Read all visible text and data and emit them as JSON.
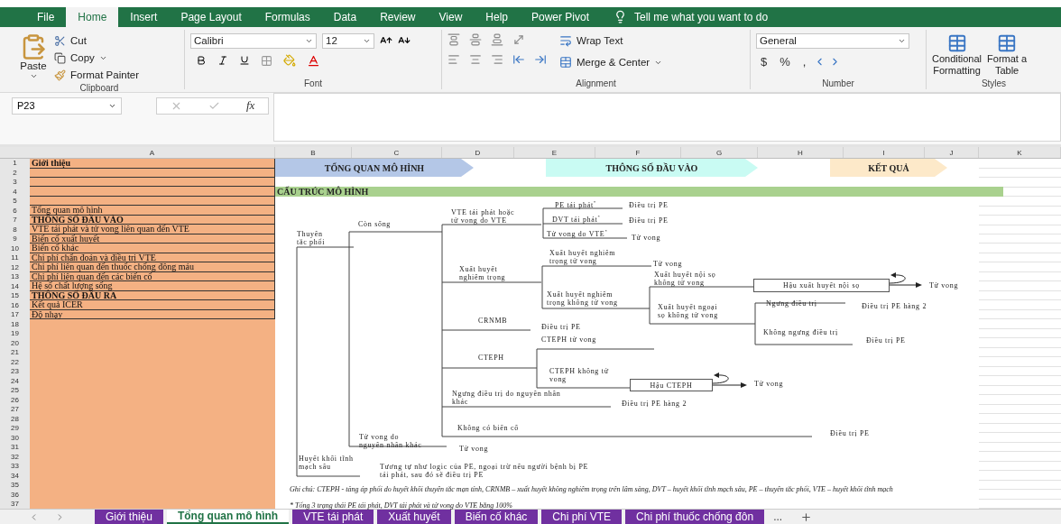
{
  "menu_tabs": [
    {
      "label": "File",
      "selected": false
    },
    {
      "label": "Home",
      "selected": true
    },
    {
      "label": "Insert",
      "selected": false
    },
    {
      "label": "Page Layout",
      "selected": false
    },
    {
      "label": "Formulas",
      "selected": false
    },
    {
      "label": "Data",
      "selected": false
    },
    {
      "label": "Review",
      "selected": false
    },
    {
      "label": "View",
      "selected": false
    },
    {
      "label": "Help",
      "selected": false
    },
    {
      "label": "Power Pivot",
      "selected": false
    }
  ],
  "tell_me": "Tell me what you want to do",
  "ribbon": {
    "clipboard": {
      "paste": "Paste",
      "cut": "Cut",
      "copy": "Copy",
      "format_painter": "Format Painter",
      "label": "Clipboard"
    },
    "font": {
      "name": "Calibri",
      "size": "12",
      "label": "Font"
    },
    "alignment": {
      "wrap_text": "Wrap Text",
      "merge_center": "Merge & Center",
      "label": "Alignment"
    },
    "number": {
      "format": "General",
      "symbols": [
        "$",
        "%",
        ","
      ],
      "label": "Number"
    },
    "styles": {
      "buttons": [
        {
          "line1": "Conditional",
          "line2": "Formatting"
        },
        {
          "line1": "Format a",
          "line2": "Table"
        }
      ],
      "label": "Styles"
    }
  },
  "formula_bar": {
    "name_box": "P23",
    "fx": "fx"
  },
  "columns": [
    "A",
    "B",
    "C",
    "D",
    "E",
    "F",
    "G",
    "H",
    "I",
    "J",
    "K"
  ],
  "rows": [
    {
      "number": "1",
      "text": "Giới thiệu",
      "kind": "heading"
    },
    {
      "number": "2",
      "kind": "empty"
    },
    {
      "number": "3",
      "kind": "empty"
    },
    {
      "number": "4",
      "kind": "empty"
    },
    {
      "number": "5",
      "kind": "empty"
    },
    {
      "number": "6",
      "text": "Tổng quan mô hình",
      "kind": "item"
    },
    {
      "number": "7",
      "text": "THÔNG SỐ ĐẦU VÀO",
      "kind": "heading"
    },
    {
      "number": "8",
      "text": "VTE tái phát và tử vong liên quan đến VTE",
      "kind": "item"
    },
    {
      "number": "9",
      "text": "Biến cố xuất huyết",
      "kind": "item"
    },
    {
      "number": "10",
      "text": "Biến cố khác",
      "kind": "item"
    },
    {
      "number": "11",
      "text": "Chi phí chẩn đoán và điều trị VTE",
      "kind": "item"
    },
    {
      "number": "12",
      "text": "Chi phí liên quan đến thuốc chống đông máu",
      "kind": "item"
    },
    {
      "number": "13",
      "text": "Chi phí liên quan đến các biến cố",
      "kind": "item"
    },
    {
      "number": "14",
      "text": "Hệ số chất lượng sống",
      "kind": "item"
    },
    {
      "number": "15",
      "text": "THÔNG SỐ ĐẦU RA",
      "kind": "heading"
    },
    {
      "number": "16",
      "text": "Kết quả ICER",
      "kind": "item"
    },
    {
      "number": "17",
      "text": "Độ nhạy",
      "kind": "item"
    },
    {
      "number": "18"
    },
    {
      "number": "19"
    },
    {
      "number": "20"
    },
    {
      "number": "21"
    },
    {
      "number": "22"
    },
    {
      "number": "23"
    },
    {
      "number": "24"
    },
    {
      "number": "25"
    },
    {
      "number": "26"
    },
    {
      "number": "27"
    },
    {
      "number": "28"
    },
    {
      "number": "29"
    },
    {
      "number": "30"
    },
    {
      "number": "31"
    },
    {
      "number": "32"
    },
    {
      "number": "33"
    },
    {
      "number": "34"
    },
    {
      "number": "35"
    },
    {
      "number": "36"
    },
    {
      "number": "37"
    }
  ],
  "banners": [
    {
      "text": "TỔNG QUAN MÔ HÌNH",
      "color": "#b4c7e7"
    },
    {
      "text": "THÔNG SỐ ĐẦU VÀO",
      "color": "#c9fbf3"
    },
    {
      "text": "KẾT QUẢ",
      "color": "#fde9c9"
    }
  ],
  "section_title": "CẤU TRÚC MÔ HÌNH",
  "diagram": {
    "labels": [
      "Thuyên\ntắc phổi",
      "Còn sống",
      "VTE tái phát hoặc\ntử vong do VTE",
      "PE tái phát$^{*}$",
      "Điều trị PE",
      "DVT tái phát$^{*}$",
      "Điều trị PE",
      "Tử vong do VTE$^{*}$",
      "Tử vong",
      "Xuất huyết nghiêm\ntrọng tử vong",
      "Tử vong",
      "Xuất huyết\nnghiêm trọng",
      "Xuất huyết nội sọ\nkhông tử vong",
      "Tử vong",
      "Xuất huyết nghiêm\ntrọng không tử vong",
      "Xuất huyết ngoại\nsọ không tử vong",
      "Ngưng điều trị",
      "Điều trị PE hàng 2",
      "CRNMB",
      "Điều trị PE",
      "CTEPH tử vong",
      "Không ngưng điều trị",
      "Điều trị PE",
      "CTEPH",
      "CTEPH không tử\nvong",
      "Tử vong",
      "Ngưng điều trị do nguyên nhân\nkhác",
      "Điều trị PE hàng 2",
      "Không có biến cố",
      "Điều trị PE",
      "Tử vong do\nnguyên nhân khác",
      "Tử vong",
      "Huyết khối tĩnh\nmạch sâu",
      "Tương tự như logic của PE, ngoại trừ nếu người bệnh bị PE\ntái phát, sau đó sẽ điều trị PE"
    ],
    "boxes": [
      "Hậu xuất huyết nội sọ",
      "Hậu CTEPH"
    ]
  },
  "notes": [
    "Ghi chú: CTEPH - tăng áp phổi do huyết khối thuyên tắc mạn tính, CRNMB – xuất huyết không nghiêm trọng trên lâm sàng, DVT – huyết khối tĩnh mạch sâu, PE – thuyên tắc phổi, VTE – huyết khối tĩnh mạch",
    "* Tổng 3 trạng thái PE tái phát, DVT tái phát và tử vong do VTE bằng 100%"
  ],
  "sheet_tabs": [
    {
      "label": "Giới thiệu",
      "selected": false
    },
    {
      "label": "Tổng quan mô hình",
      "selected": true
    },
    {
      "label": "VTE tái phát",
      "selected": false
    },
    {
      "label": "Xuất huyết",
      "selected": false
    },
    {
      "label": "Biến cố khác",
      "selected": false
    },
    {
      "label": "Chi phí VTE",
      "selected": false
    },
    {
      "label": "Chi phí thuốc chống đôn",
      "selected": false
    }
  ],
  "more_tabs": "..."
}
